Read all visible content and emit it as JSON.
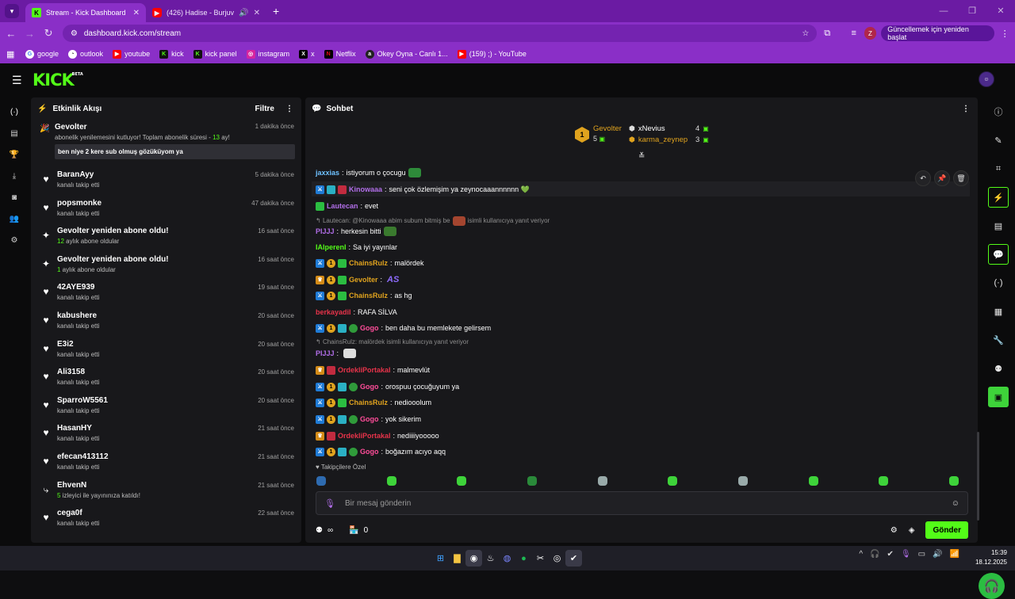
{
  "browser": {
    "tabs": [
      {
        "title": "Stream - Kick Dashboard",
        "icon": "kick-favicon",
        "active": true
      },
      {
        "title": "(426) Hadise - Burjuva (Offi",
        "icon": "youtube-favicon",
        "active": false
      }
    ],
    "url": "dashboard.kick.com/stream",
    "profile_initial": "Z",
    "update_label": "Güncellemek için yeniden başlat",
    "bookmarks": [
      {
        "label": "google",
        "icon": "google-icon"
      },
      {
        "label": "outlook",
        "icon": "outlook-icon"
      },
      {
        "label": "youtube",
        "icon": "youtube-icon"
      },
      {
        "label": "kick",
        "icon": "kick-icon"
      },
      {
        "label": "kick panel",
        "icon": "kick-icon"
      },
      {
        "label": "instagram",
        "icon": "instagram-icon"
      },
      {
        "label": "x",
        "icon": "x-icon"
      },
      {
        "label": "Netflix",
        "icon": "netflix-icon"
      },
      {
        "label": "Okey Oyna - Canlı 1...",
        "icon": "okey-icon"
      },
      {
        "label": "(159) ;) - YouTube",
        "icon": "youtube-icon"
      }
    ]
  },
  "kick": {
    "logo": "KICK",
    "logo_badge": "BETA",
    "activity": {
      "title": "Etkinlik Akışı",
      "filter_label": "Filtre",
      "events": [
        {
          "name": "Gevolter",
          "text": "abonelik yenilemesini kutluyor! Toplam abonelik süresi - ",
          "highlight": "13",
          "text_after": " ay!",
          "time": "1 dakika önce",
          "message": "ben niye 2 kere sub olmuş gözüküyom ya",
          "icon": "celebrate-icon"
        },
        {
          "name": "BaranAyy",
          "text": "kanalı takip etti",
          "time": "5 dakika önce",
          "icon": "heart-icon"
        },
        {
          "name": "popsmonke",
          "text": "kanalı takip etti",
          "time": "47 dakika önce",
          "icon": "heart-icon"
        },
        {
          "name": "Gevolter yeniden abone oldu!",
          "highlight": "12",
          "text": " aylık abone oldular",
          "time": "16 saat önce",
          "icon": "sparkle-icon"
        },
        {
          "name": "Gevolter yeniden abone oldu!",
          "highlight": "1",
          "text": " aylık abone oldular",
          "time": "16 saat önce",
          "icon": "sparkle-icon"
        },
        {
          "name": "42AYE939",
          "text": "kanalı takip etti",
          "time": "19 saat önce",
          "icon": "heart-icon"
        },
        {
          "name": "kabushere",
          "text": "kanalı takip etti",
          "time": "20 saat önce",
          "icon": "heart-icon"
        },
        {
          "name": "E3i2",
          "text": "kanalı takip etti",
          "time": "20 saat önce",
          "icon": "heart-icon"
        },
        {
          "name": "Ali3158",
          "text": "kanalı takip etti",
          "time": "20 saat önce",
          "icon": "heart-icon"
        },
        {
          "name": "SparroW5561",
          "text": "kanalı takip etti",
          "time": "20 saat önce",
          "icon": "heart-icon"
        },
        {
          "name": "HasanHY",
          "text": "kanalı takip etti",
          "time": "21 saat önce",
          "icon": "heart-icon"
        },
        {
          "name": "efecan413112",
          "text": "kanalı takip etti",
          "time": "21 saat önce",
          "icon": "heart-icon"
        },
        {
          "name": "EhvenN",
          "highlight": "5",
          "text": " izleyici ile yayınınıza katıldı!",
          "time": "21 saat önce",
          "icon": "raid-icon"
        },
        {
          "name": "cega0f",
          "text": "kanalı takip etti",
          "time": "22 saat önce",
          "icon": "heart-icon"
        }
      ]
    },
    "chat": {
      "title": "Sohbet",
      "leaderboard": [
        {
          "name": "Gevolter",
          "rank": "1",
          "count": "5",
          "color": "#e0a31e"
        },
        {
          "name": "xNevius",
          "count": "4",
          "color": "#ffffff"
        },
        {
          "name": "karma_zeynep",
          "count": "3",
          "color": "#e0a31e"
        }
      ],
      "messages": [
        {
          "user": "jaxxias",
          "color": "#6ec1ff",
          "text": "istiyorum o çocugu",
          "badges": [],
          "emote": "#2e8b3a"
        },
        {
          "user": "Kinowaaa",
          "color": "#b16ee8",
          "text": "seni çok özlemişim ya zeynocaaannnnnn 💚",
          "badges": [
            "b-blue",
            "b-teal",
            "b-red"
          ]
        },
        {
          "user": "Lautecan",
          "color": "#b16ee8",
          "text": "evet",
          "badges": [
            "b-green"
          ]
        },
        {
          "reply": "Lautecan: @Kinowaaa abim subum bitmiş be",
          "reply_after": "isimli kullanıcıya yanıt veriyor"
        },
        {
          "user": "PIJJJ",
          "color": "#b16ee8",
          "text": "herkesin bitti",
          "badges": [],
          "emote": "#3a7a2e"
        },
        {
          "user": "IAlperenI",
          "color": "#53fc18",
          "text": "Sa iyi yayınlar",
          "badges": []
        },
        {
          "user": "ChainsRulz",
          "color": "#e0a31e",
          "text": "malördek",
          "badges": [
            "b-blue",
            "b-gold",
            "b-green"
          ]
        },
        {
          "user": "Gevolter",
          "color": "#e0a31e",
          "text": "",
          "badges": [
            "b-crown",
            "b-gold",
            "b-green"
          ],
          "emote_text": "AS"
        },
        {
          "user": "ChainsRulz",
          "color": "#e0a31e",
          "text": "as hg",
          "badges": [
            "b-blue",
            "b-gold",
            "b-green"
          ]
        },
        {
          "user": "berkayadil",
          "color": "#e8334a",
          "text": "RAFA SİLVA",
          "badges": []
        },
        {
          "user": "Gogo",
          "color": "#ff4d9a",
          "text": "ben daha bu memlekete gelirsem",
          "badges": [
            "b-blue",
            "b-gold",
            "b-teal",
            "b-mod"
          ]
        },
        {
          "reply": "ChainsRulz: malördek isimli kullanıcıya yanıt veriyor",
          "reply_after": ""
        },
        {
          "user": "PIJJJ",
          "color": "#b16ee8",
          "text": "",
          "badges": [],
          "emote": "#dddddd"
        },
        {
          "user": "OrdekliPortakal",
          "color": "#e8334a",
          "text": "malmevlüt",
          "badges": [
            "b-crown",
            "b-red"
          ]
        },
        {
          "user": "Gogo",
          "color": "#ff4d9a",
          "text": "orospuu çocuğuyum ya",
          "badges": [
            "b-blue",
            "b-gold",
            "b-teal",
            "b-mod"
          ]
        },
        {
          "user": "ChainsRulz",
          "color": "#e0a31e",
          "text": "nediooolum",
          "badges": [
            "b-blue",
            "b-gold",
            "b-green"
          ]
        },
        {
          "user": "Gogo",
          "color": "#ff4d9a",
          "text": "yok sikerim",
          "badges": [
            "b-blue",
            "b-gold",
            "b-teal",
            "b-mod"
          ]
        },
        {
          "user": "OrdekliPortakal",
          "color": "#e8334a",
          "text": "nediiiiyooooo",
          "badges": [
            "b-crown",
            "b-red"
          ]
        },
        {
          "user": "Gogo",
          "color": "#ff4d9a",
          "text": "boğazım acıyo aqq",
          "badges": [
            "b-blue",
            "b-gold",
            "b-teal",
            "b-mod"
          ]
        }
      ],
      "followers_only_label": "Takipçilere Özel",
      "input_placeholder": "Bir mesaj gönderin",
      "points_value": "0",
      "send_label": "Gönder"
    }
  },
  "taskbar": {
    "time": "15:39",
    "date": "18.12.2025"
  }
}
